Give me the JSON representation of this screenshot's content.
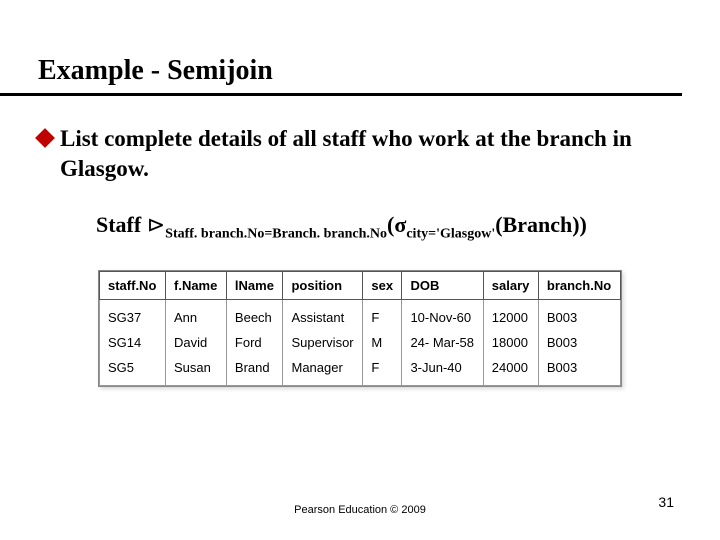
{
  "title": "Example - Semijoin",
  "bullet": "List complete details of all staff who work at the branch in Glasgow.",
  "formula": {
    "lhs": "Staff",
    "join_sub": "Staff. branch.No=Branch. branch.No",
    "sigma_sub": "city='Glasgow'",
    "rhs": "(Branch))"
  },
  "table": {
    "headers": [
      "staff.No",
      "f.Name",
      "lName",
      "position",
      "sex",
      "DOB",
      "salary",
      "branch.No"
    ],
    "rows": [
      [
        "SG37",
        "Ann",
        "Beech",
        "Assistant",
        "F",
        "10-Nov-60",
        "12000",
        "B003"
      ],
      [
        "SG14",
        "David",
        "Ford",
        "Supervisor",
        "M",
        "24- Mar-58",
        "18000",
        "B003"
      ],
      [
        "SG5",
        "Susan",
        "Brand",
        "Manager",
        "F",
        "3-Jun-40",
        "24000",
        "B003"
      ]
    ]
  },
  "footer": "Pearson Education © 2009",
  "page": "31"
}
